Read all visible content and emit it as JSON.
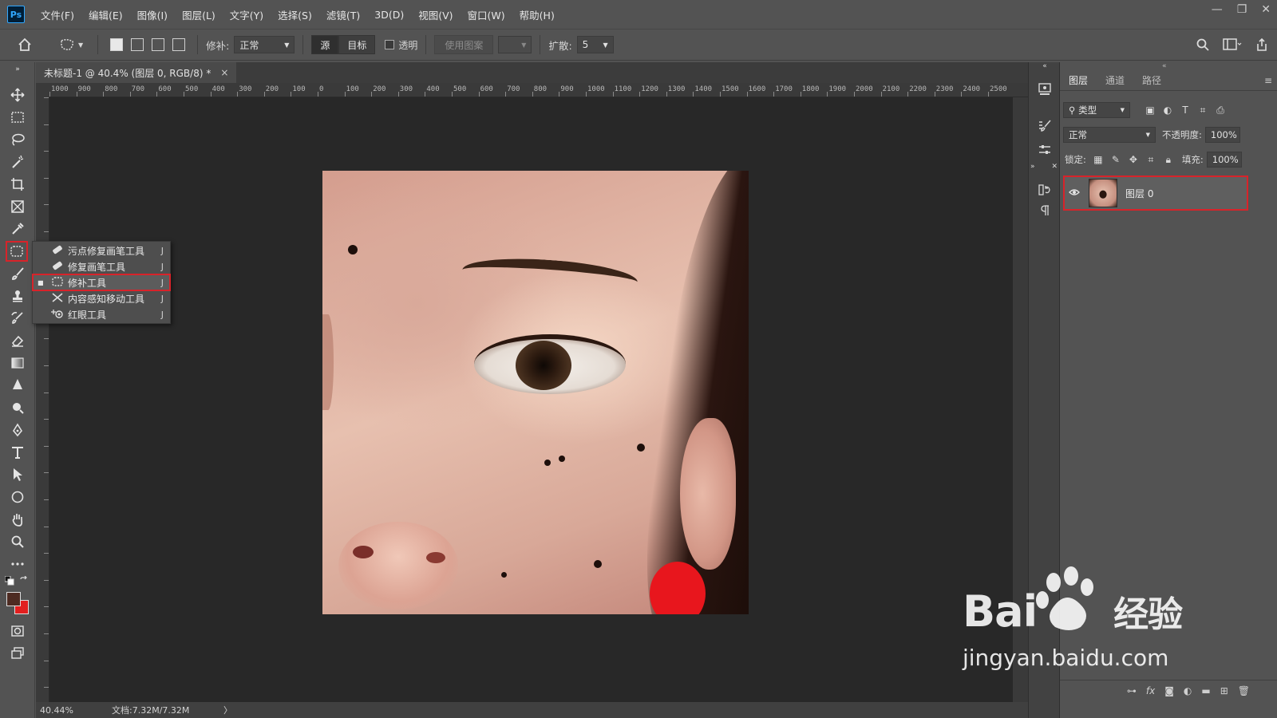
{
  "app": {
    "logo": "Ps"
  },
  "menu": [
    "文件(F)",
    "编辑(E)",
    "图像(I)",
    "图层(L)",
    "文字(Y)",
    "选择(S)",
    "滤镜(T)",
    "3D(D)",
    "视图(V)",
    "窗口(W)",
    "帮助(H)"
  ],
  "window_controls": {
    "minimize": "—",
    "restore": "❐",
    "close": "✕"
  },
  "options": {
    "patch_label": "修补:",
    "patch_mode": "正常",
    "source_label": "源",
    "target_label": "目标",
    "transparent_label": "透明",
    "use_pattern_label": "使用图案",
    "diffusion_label": "扩散:",
    "diffusion_value": "5"
  },
  "document": {
    "tab_title": "未标题-1 @ 40.4% (图层 0, RGB/8) *",
    "close": "×",
    "zoom": "40.44%",
    "doc_size": "文档:7.32M/7.32M",
    "status_arrow": "〉"
  },
  "ruler_h_labels": [
    "1000",
    "900",
    "800",
    "700",
    "600",
    "500",
    "400",
    "300",
    "200",
    "100",
    "0",
    "100",
    "200",
    "300",
    "400",
    "500",
    "600",
    "700",
    "800",
    "900",
    "1000",
    "1100",
    "1200",
    "1300",
    "1400",
    "1500",
    "1600",
    "1700",
    "1800",
    "1900",
    "2000",
    "2100",
    "2200",
    "2300",
    "2400",
    "2500"
  ],
  "tool_flyout": [
    {
      "label": "污点修复画笔工具",
      "key": "J",
      "icon": "spot-healing-brush-icon",
      "selected": false
    },
    {
      "label": "修复画笔工具",
      "key": "J",
      "icon": "healing-brush-icon",
      "selected": false
    },
    {
      "label": "修补工具",
      "key": "J",
      "icon": "patch-tool-icon",
      "selected": true
    },
    {
      "label": "内容感知移动工具",
      "key": "J",
      "icon": "content-aware-move-icon",
      "selected": false
    },
    {
      "label": "红眼工具",
      "key": "J",
      "icon": "red-eye-icon",
      "selected": false
    }
  ],
  "colors": {
    "foreground": "#4d2b22",
    "background": "#e21f1f",
    "highlight": "#d8232a"
  },
  "layers_panel": {
    "tabs": [
      "图层",
      "通道",
      "路径"
    ],
    "filter_kind": "类型",
    "blend_mode": "正常",
    "opacity_label": "不透明度:",
    "opacity_value": "100%",
    "lock_label": "锁定:",
    "fill_label": "填充:",
    "fill_value": "100%",
    "layers": [
      {
        "name": "图层 0",
        "visible": true
      }
    ]
  },
  "watermark": {
    "brand": "Bai",
    "brand_suffix": "经验",
    "url": "jingyan.baidu.com"
  }
}
